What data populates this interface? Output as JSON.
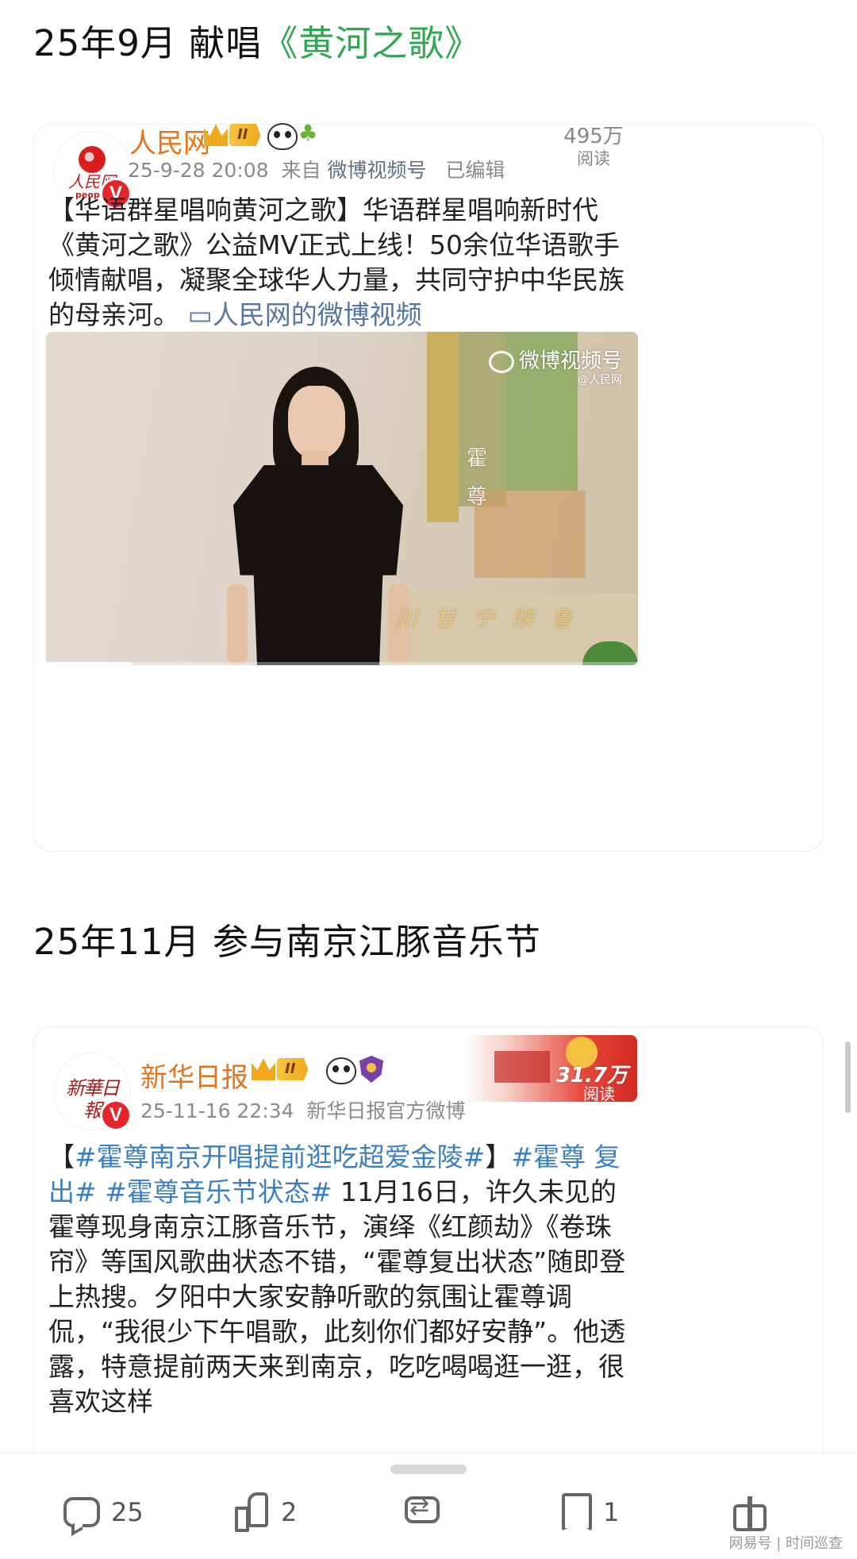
{
  "section1": {
    "prefix": "25年9月 献唱",
    "highlight": "《黄河之歌》"
  },
  "post1": {
    "avatar_logo_cn": "人民网",
    "avatar_logo_en": "people",
    "verified_mark": "V",
    "account_name": "人民网",
    "vip_level": "II",
    "timestamp": "25-9-28 20:08",
    "source_prefix": "来自",
    "source": "微博视频号",
    "edited": "已编辑",
    "read_count": "495万",
    "read_label": "阅读",
    "text_main": "【华语群星唱响黄河之歌】华语群星唱响新时代《黄河之歌》公益MV正式上线！50余位华语歌手倾情献唱，凝聚全球华人力量，共同守护中华民族的母亲河。",
    "text_link": "人民网的微博视频",
    "video": {
      "watermark": "微博视频号",
      "watermark_sub": "@人民网",
      "caption_char1": "霍",
      "caption_char2": "尊",
      "subtitle": "川 甘 宁    陕     鲁",
      "progress": 0.145
    }
  },
  "section2": {
    "title": "25年11月 参与南京江豚音乐节"
  },
  "post2": {
    "avatar_logo": "新華日報",
    "verified_mark": "V",
    "account_name": "新华日报",
    "vip_level": "II",
    "timestamp": "25-11-16 22:34",
    "source": "新华日报官方微博",
    "read_count": "31.7万",
    "read_label": "阅读",
    "text_bracket_open": "【",
    "tag1": "#霍尊南京开唱提前逛吃超爱金陵#",
    "text_bracket_close": "】",
    "tag2": "#霍尊 复出#",
    "tag3": " #霍尊音乐节状态#",
    "text_body": " 11月16日，许久未见的霍尊现身南京江豚音乐节，演绎《红颜劫》《卷珠帘》等国风歌曲状态不错，“霍尊复出状态”随即登上热搜。夕阳中大家安静听歌的氛围让霍尊调侃，“我很少下午唱歌，此刻你们都好安静”。他透露，特意提前两天来到南京，吃吃喝喝逛一逛，很喜欢这样"
  },
  "bottom_bar": {
    "comment_count": "25",
    "like_count": "2",
    "favorite_count": "1",
    "footer_brand": "网易号 | 时间巡查"
  }
}
